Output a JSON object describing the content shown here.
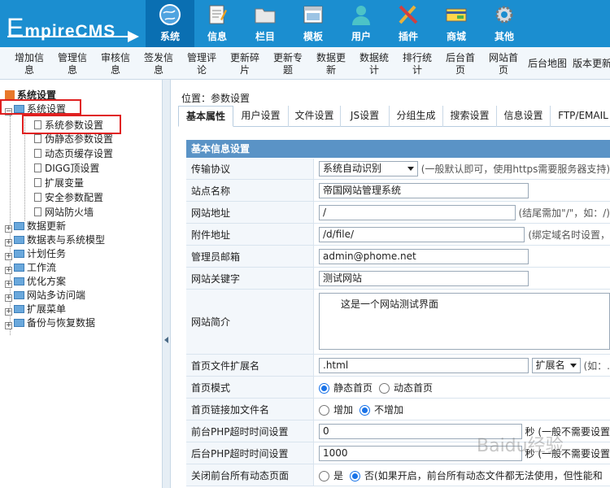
{
  "brand": {
    "logo_text": "mpireCMS",
    "logo_first": "E"
  },
  "nav": [
    {
      "label": "系统",
      "icon": "globe-icon",
      "active": true
    },
    {
      "label": "信息",
      "icon": "notepad-icon"
    },
    {
      "label": "栏目",
      "icon": "folder-icon"
    },
    {
      "label": "模板",
      "icon": "window-icon"
    },
    {
      "label": "用户",
      "icon": "user-icon"
    },
    {
      "label": "插件",
      "icon": "tools-icon"
    },
    {
      "label": "商城",
      "icon": "card-icon"
    },
    {
      "label": "其他",
      "icon": "gear-icon"
    }
  ],
  "subnav": [
    "增加信息",
    "管理信息",
    "审核信息",
    "签发信息",
    "管理评论",
    "更新碎片",
    "更新专题",
    "数据更新",
    "数据统计",
    "排行统计",
    "后台首页",
    "网站首页",
    "后台地图",
    "版本更新"
  ],
  "tree": {
    "root": "系统设置",
    "open_folder": "系统设置",
    "children": [
      "系统参数设置",
      "伪静态参数设置",
      "动态页缓存设置",
      "DIGG顶设置",
      "扩展变量",
      "安全参数配置",
      "网站防火墙"
    ],
    "folders": [
      "数据更新",
      "数据表与系统模型",
      "计划任务",
      "工作流",
      "优化方案",
      "网站多访问端",
      "扩展菜单",
      "备份与恢复数据"
    ]
  },
  "breadcrumb": {
    "label": "位置：",
    "current": "参数设置"
  },
  "tabs": [
    "基本属性",
    "用户设置",
    "文件设置",
    "JS设置",
    "分组生成",
    "搜索设置",
    "信息设置",
    "FTP/EMAIL"
  ],
  "form": {
    "header": "基本信息设置",
    "protocol": {
      "label": "传输协议",
      "value": "系统自动识别",
      "hint": "(一般默认即可，使用https需要服务器支持)"
    },
    "sitename": {
      "label": "站点名称",
      "value": "帝国网站管理系统"
    },
    "siteurl": {
      "label": "网站地址",
      "value": "/",
      "hint": "(结尾需加\"/\"，如：/)"
    },
    "fileurl": {
      "label": "附件地址",
      "value": "/d/file/",
      "hint": "(绑定域名时设置，"
    },
    "email": {
      "label": "管理员邮箱",
      "value": "admin@phome.net"
    },
    "keywords": {
      "label": "网站关键字",
      "value": "测试网站"
    },
    "intro": {
      "label": "网站简介",
      "value": "这是一个网站测试界面"
    },
    "indexext": {
      "label": "首页文件扩展名",
      "value": ".html",
      "select": "扩展名",
      "hint": "(如：."
    },
    "indexmode": {
      "label": "首页模式",
      "opt1": "静态首页",
      "opt2": "动态首页"
    },
    "indexlink": {
      "label": "首页链接加文件名",
      "opt1": "增加",
      "opt2": "不增加"
    },
    "fronttimeout": {
      "label": "前台PHP超时时间设置",
      "value": "0",
      "hint": "秒 (一般不需要设置"
    },
    "backtimeout": {
      "label": "后台PHP超时时间设置",
      "value": "1000",
      "hint": "秒 (一般不需要设置"
    },
    "closedynamic": {
      "label": "关闭前台所有动态页面",
      "opt1": "是",
      "opt2": "否",
      "hint": "(如果开启，前台所有动态文件都无法使用，但性能和"
    }
  },
  "watermark": "Baidu经验"
}
